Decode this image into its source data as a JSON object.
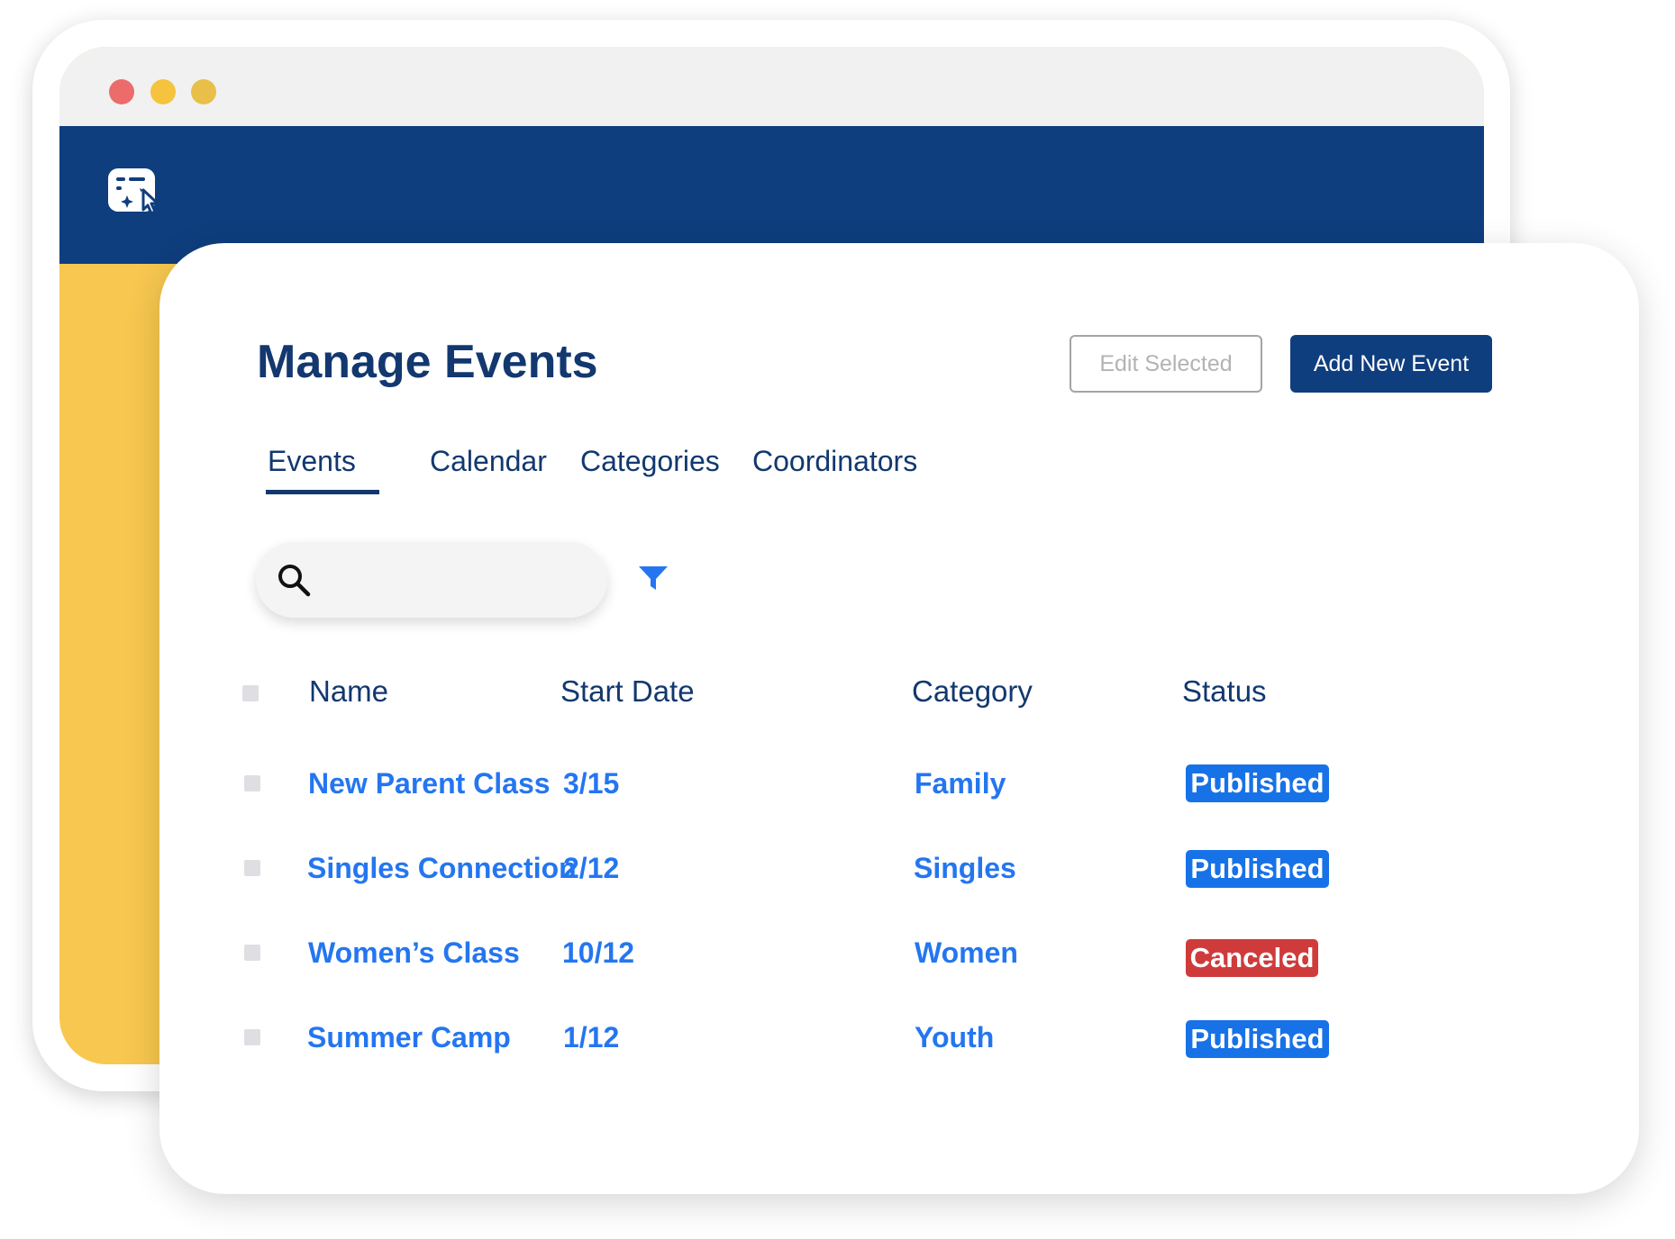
{
  "window": {
    "traffic_lights": [
      "#ec6b6b",
      "#f5c33d",
      "#e8bf48"
    ],
    "header_color": "#0f3e7e",
    "sidebar_color": "#f7c74f",
    "logo_icon": "calendar-cursor-icon"
  },
  "page": {
    "title": "Manage Events"
  },
  "toolbar": {
    "edit_label": "Edit Selected",
    "add_label": "Add New Event"
  },
  "tabs": [
    {
      "label": "Events",
      "active": true
    },
    {
      "label": "Calendar",
      "active": false
    },
    {
      "label": "Categories",
      "active": false
    },
    {
      "label": "Coordinators",
      "active": false
    }
  ],
  "search": {
    "placeholder": "",
    "value": "",
    "icon": "search-icon"
  },
  "filter": {
    "icon": "filter-icon",
    "color": "#2476f0"
  },
  "table": {
    "columns": [
      "Name",
      "Start Date",
      "Category",
      "Status"
    ],
    "rows": [
      {
        "name": "New Parent Class",
        "start_date": "3/15",
        "category": "Family",
        "status": "Published"
      },
      {
        "name": "Singles Connection",
        "start_date": "2/12",
        "category": "Singles",
        "status": "Published"
      },
      {
        "name": "Women’s Class",
        "start_date": "10/12",
        "category": "Women",
        "status": "Canceled"
      },
      {
        "name": "Summer Camp",
        "start_date": "1/12",
        "category": "Youth",
        "status": "Published"
      }
    ]
  },
  "colors": {
    "primary": "#0f3e7e",
    "link": "#2476f0",
    "published": "#1772e8",
    "canceled": "#cf3b3b"
  }
}
